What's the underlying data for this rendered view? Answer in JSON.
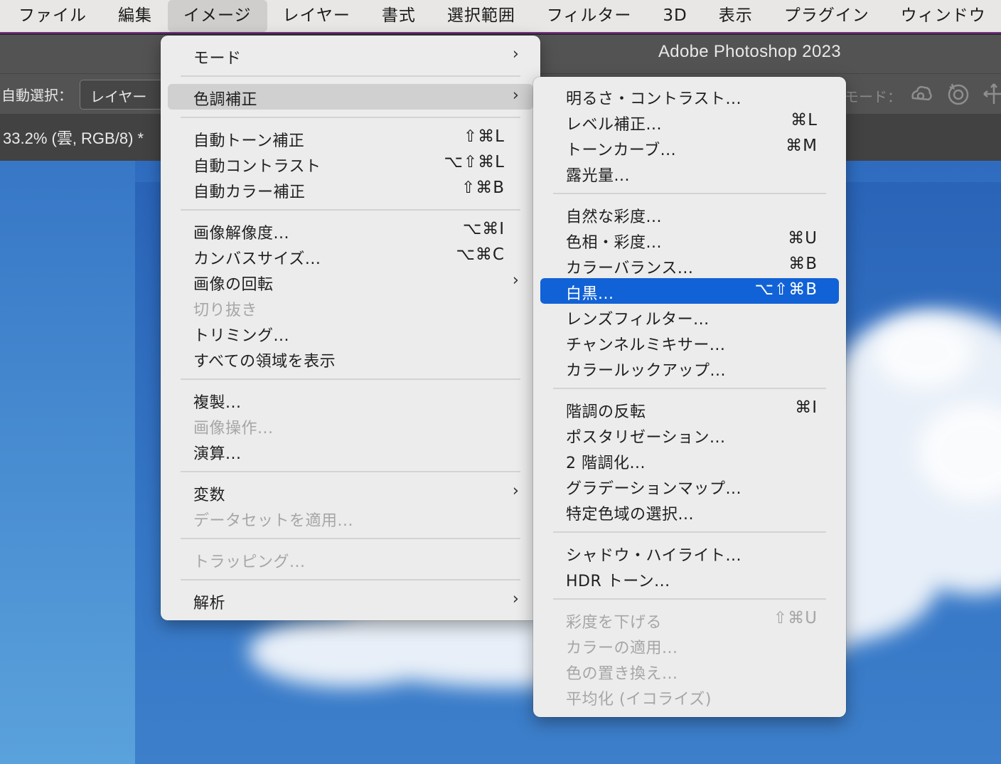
{
  "menubar": {
    "items": [
      "ファイル",
      "編集",
      "イメージ",
      "レイヤー",
      "書式",
      "選択範囲",
      "フィルター",
      "3D",
      "表示",
      "プラグイン",
      "ウィンドウ"
    ],
    "active": "イメージ"
  },
  "app": {
    "title": "Adobe Photoshop 2023"
  },
  "options_bar": {
    "auto_select_label": "自動選択：",
    "layer_select_value": "レイヤー",
    "mode_label": "モード："
  },
  "document": {
    "tab_title": "33.2% (雲, RGB/8) *"
  },
  "image_menu": {
    "items": [
      {
        "label": "モード",
        "submenu": true
      },
      {
        "label": "色調補正",
        "submenu": true,
        "state": "hover"
      },
      {
        "label": "自動トーン補正",
        "shortcut": "⇧⌘L"
      },
      {
        "label": "自動コントラスト",
        "shortcut": "⌥⇧⌘L"
      },
      {
        "label": "自動カラー補正",
        "shortcut": "⇧⌘B"
      },
      {
        "label": "画像解像度...",
        "shortcut": "⌥⌘I"
      },
      {
        "label": "カンバスサイズ...",
        "shortcut": "⌥⌘C"
      },
      {
        "label": "画像の回転",
        "submenu": true
      },
      {
        "label": "切り抜き",
        "disabled": true
      },
      {
        "label": "トリミング..."
      },
      {
        "label": "すべての領域を表示"
      },
      {
        "label": "複製..."
      },
      {
        "label": "画像操作...",
        "disabled": true
      },
      {
        "label": "演算..."
      },
      {
        "label": "変数",
        "submenu": true
      },
      {
        "label": "データセットを適用...",
        "disabled": true
      },
      {
        "label": "トラッピング...",
        "disabled": true
      },
      {
        "label": "解析",
        "submenu": true
      }
    ]
  },
  "adjust_menu": {
    "items": [
      {
        "label": "明るさ・コントラスト..."
      },
      {
        "label": "レベル補正...",
        "shortcut": "⌘L"
      },
      {
        "label": "トーンカーブ...",
        "shortcut": "⌘M"
      },
      {
        "label": "露光量..."
      },
      {
        "label": "自然な彩度..."
      },
      {
        "label": "色相・彩度...",
        "shortcut": "⌘U"
      },
      {
        "label": "カラーバランス...",
        "shortcut": "⌘B"
      },
      {
        "label": "白黒...",
        "shortcut": "⌥⇧⌘B",
        "state": "selected"
      },
      {
        "label": "レンズフィルター..."
      },
      {
        "label": "チャンネルミキサー..."
      },
      {
        "label": "カラールックアップ..."
      },
      {
        "label": "階調の反転",
        "shortcut": "⌘I"
      },
      {
        "label": "ポスタリゼーション..."
      },
      {
        "label": "2 階調化..."
      },
      {
        "label": "グラデーションマップ..."
      },
      {
        "label": "特定色域の選択..."
      },
      {
        "label": "シャドウ・ハイライト..."
      },
      {
        "label": "HDR トーン..."
      },
      {
        "label": "彩度を下げる",
        "shortcut": "⇧⌘U",
        "disabled": true
      },
      {
        "label": "カラーの適用...",
        "disabled": true
      },
      {
        "label": "色の置き換え...",
        "disabled": true
      },
      {
        "label": "平均化 (イコライズ)",
        "disabled": true
      }
    ]
  },
  "submenu_arrow": "›"
}
